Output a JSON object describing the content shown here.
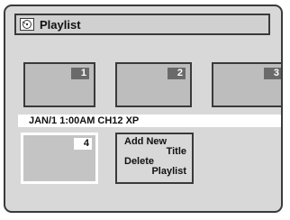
{
  "header": {
    "title": "Playlist",
    "icon": "playlist-icon"
  },
  "thumbnails": [
    {
      "number": "1",
      "selected": false
    },
    {
      "number": "2",
      "selected": false
    },
    {
      "number": "3",
      "selected": false
    },
    {
      "number": "4",
      "selected": true
    }
  ],
  "info": {
    "text": "JAN/1 1:00AM CH12 XP"
  },
  "menu": {
    "items": [
      {
        "line1": "Add New",
        "line2": "Title"
      },
      {
        "line1": "Delete",
        "line2": "Playlist"
      }
    ]
  },
  "colors": {
    "background": "#d8d8d8",
    "border": "#3a3a3a",
    "thumb_fill": "#bdbdbd",
    "number_badge": "#6a6a6a",
    "selected_border": "#ffffff"
  }
}
